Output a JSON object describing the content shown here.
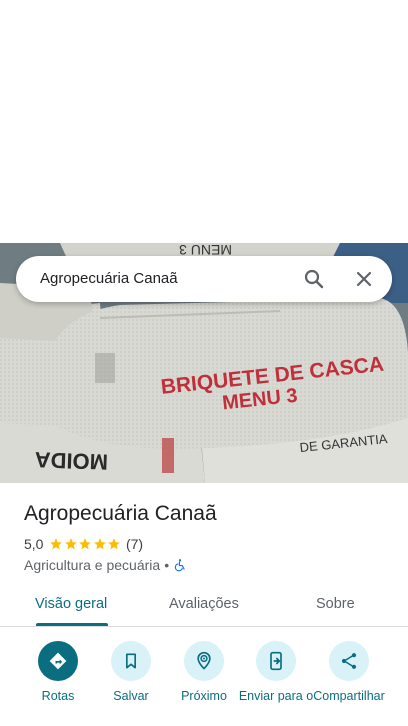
{
  "search": {
    "query": "Agropecuária Canaã"
  },
  "place": {
    "name": "Agropecuária Canaã",
    "rating": "5,0",
    "reviews_count": "(7)",
    "stars": 5,
    "category": "Agricultura e pecuária",
    "separator": "•",
    "accessibility_icon": "wheelchair-icon"
  },
  "photo": {
    "bag_text_1": "BRIQUETE DE CASCA",
    "bag_text_2": "MENU 3",
    "top_bag_text": "MENU 3",
    "left_bag_text": "MOIDA",
    "right_bag_text": "DE GARANTIA"
  },
  "tabs": [
    {
      "label": "Visão geral",
      "active": true
    },
    {
      "label": "Avaliações",
      "active": false
    },
    {
      "label": "Sobre",
      "active": false
    }
  ],
  "actions": [
    {
      "label": "Rotas",
      "icon": "directions-icon"
    },
    {
      "label": "Salvar",
      "icon": "bookmark-icon"
    },
    {
      "label": "Próximo",
      "icon": "nearby-icon"
    },
    {
      "label": "Enviar para o",
      "icon": "send-to-phone-icon"
    },
    {
      "label": "Compartilhar",
      "icon": "share-icon"
    }
  ],
  "colors": {
    "accent": "#0a6e80",
    "accent_light": "#d8f2f7",
    "star": "#fbbc04"
  }
}
